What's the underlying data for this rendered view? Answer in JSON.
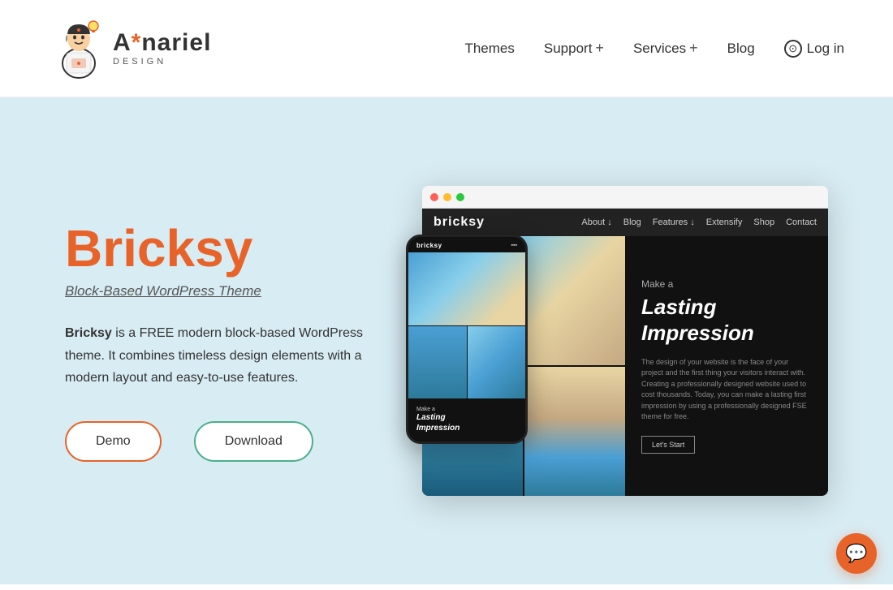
{
  "header": {
    "logo": {
      "name": "Anariel",
      "tagline": "DESIGN"
    },
    "nav": {
      "items": [
        {
          "label": "Themes",
          "hasPlus": false
        },
        {
          "label": "Support",
          "hasPlus": true
        },
        {
          "label": "Services",
          "hasPlus": true
        },
        {
          "label": "Blog",
          "hasPlus": false
        }
      ],
      "login": "Log in"
    }
  },
  "hero": {
    "title": "Bricksy",
    "subtitle": "Block-Based WordPress Theme",
    "description_prefix": "Bricksy",
    "description_body": " is a FREE modern block-based WordPress theme. It combines timeless design elements with a modern layout and easy-to-use features.",
    "buttons": {
      "demo": "Demo",
      "download": "Download"
    }
  },
  "desktop_preview": {
    "brand": "bricksy",
    "nav_links": [
      "About ↓",
      "Blog",
      "Features ↓",
      "Extensify",
      "Shop",
      "Contact"
    ],
    "tagline_make": "Make a",
    "tagline_lasting": "Lasting",
    "tagline_impression": "Impression",
    "body_text": "The design of your website is the face of your project and the first thing your visitors interact with. Creating a professionally designed website used to cost thousands. Today, you can make a lasting first impression by using a professionally designed FSE theme for free.",
    "cta": "Let's Start"
  },
  "mobile_preview": {
    "brand": "bricksy",
    "caption_make": "Make a",
    "caption_lasting": "Lasting",
    "caption_impression": "Impression"
  },
  "chat": {
    "icon": "💬"
  }
}
